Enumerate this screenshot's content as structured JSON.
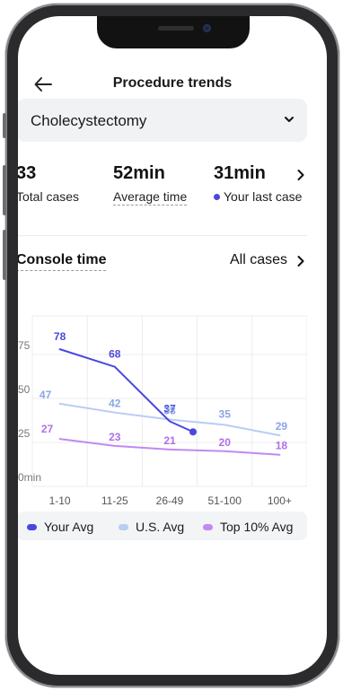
{
  "header": {
    "title": "Procedure trends"
  },
  "procedure_selector": {
    "value": "Cholecystectomy"
  },
  "stats": [
    {
      "value": "33",
      "label": "Total cases"
    },
    {
      "value": "52min",
      "label": "Average time"
    },
    {
      "value": "31min",
      "label": "Your last case"
    }
  ],
  "section": {
    "title": "Console time",
    "filter_label": "All cases"
  },
  "colors": {
    "your_avg": "#4a47e0",
    "us_avg": "#b9ccf5",
    "top10": "#c08af0"
  },
  "chart_data": {
    "type": "line",
    "categories": [
      "1-10",
      "11-25",
      "26-49",
      "51-100",
      "100+"
    ],
    "y_ticks": [
      "0min",
      "25",
      "50",
      "75"
    ],
    "ylim": [
      0,
      100
    ],
    "grid": true,
    "legend_placement": "bottom",
    "series": [
      {
        "name": "Your Avg",
        "values": [
          78,
          68,
          37
        ],
        "labels": [
          "78",
          "68",
          "37"
        ],
        "last_case": 31
      },
      {
        "name": "U.S. Avg",
        "values": [
          47,
          42,
          38,
          35,
          29
        ],
        "labels": [
          "47",
          "42",
          "38",
          "35",
          "29"
        ]
      },
      {
        "name": "Top 10% Avg",
        "values": [
          27,
          23,
          21,
          20,
          18
        ],
        "labels": [
          "27",
          "23",
          "21",
          "20",
          "18"
        ]
      }
    ]
  }
}
